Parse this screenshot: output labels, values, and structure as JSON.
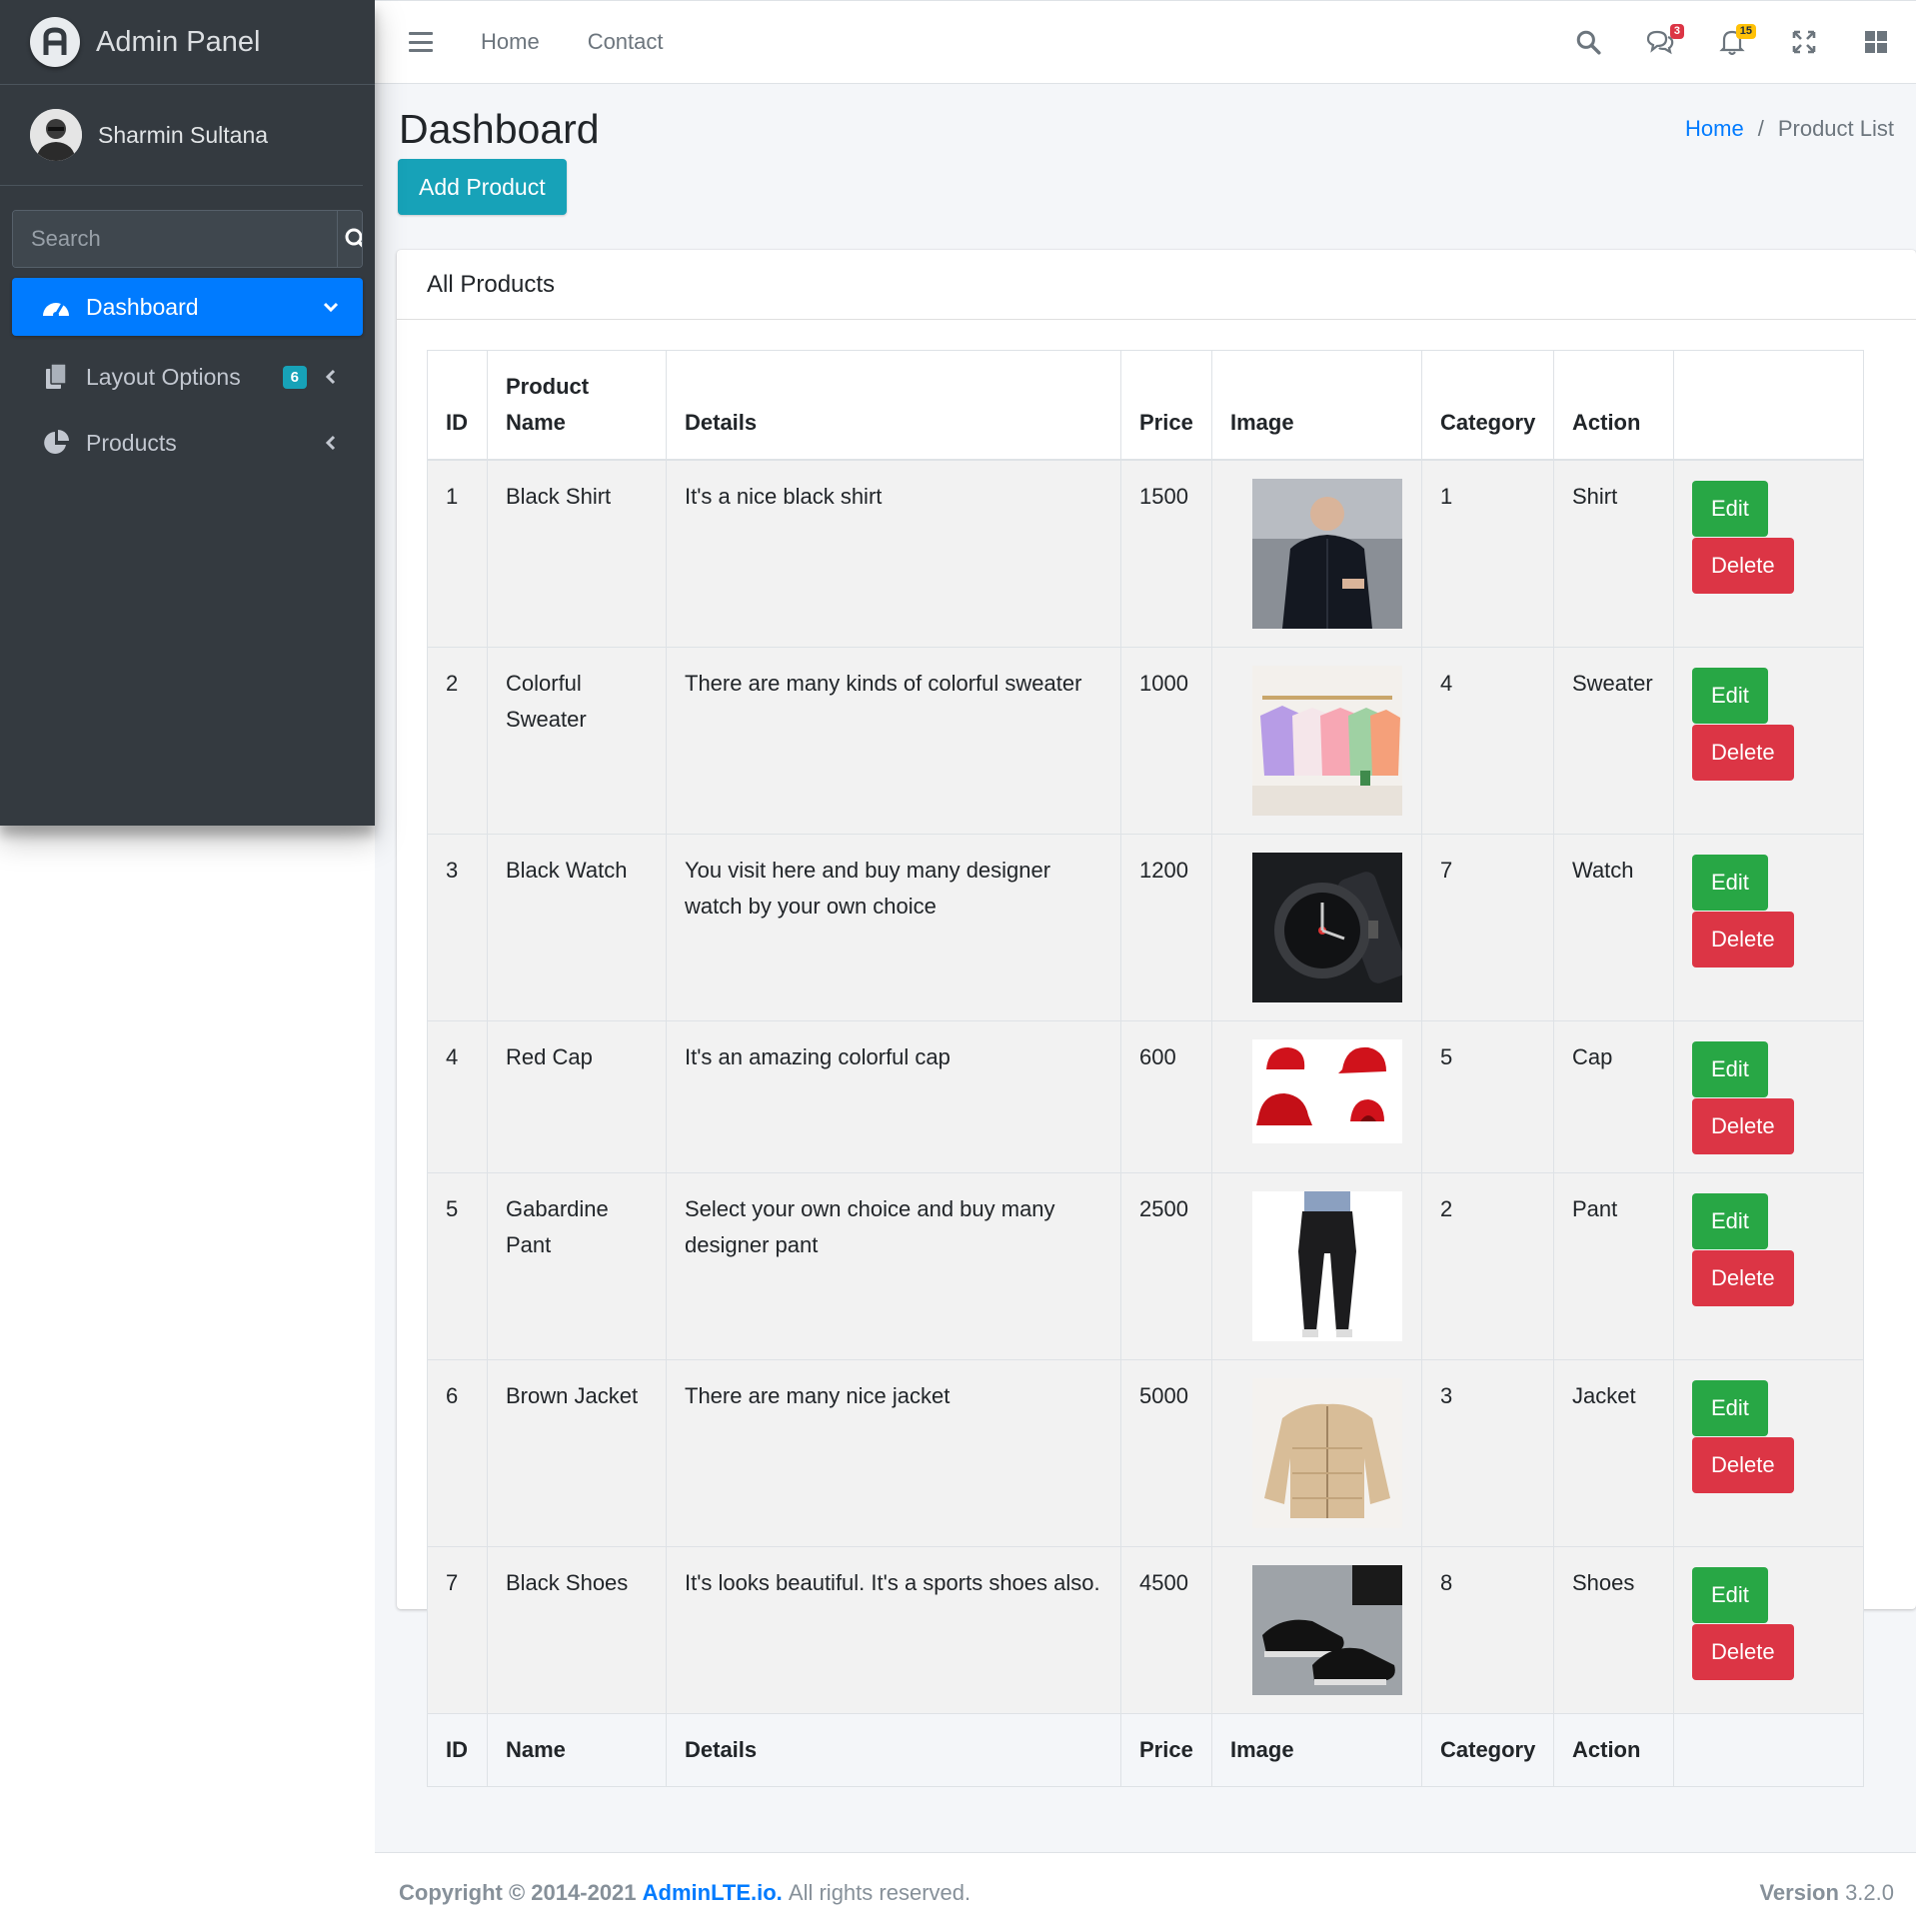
{
  "brand": {
    "name": "Admin Panel"
  },
  "user": {
    "name": "Sharmin Sultana"
  },
  "sidebar": {
    "search_placeholder": "Search",
    "items": [
      {
        "label": "Dashboard",
        "active": true
      },
      {
        "label": "Layout Options",
        "badge": "6"
      },
      {
        "label": "Products"
      }
    ]
  },
  "topbar": {
    "links": [
      "Home",
      "Contact"
    ],
    "messages_badge": "3",
    "notifications_badge": "15"
  },
  "page": {
    "title": "Dashboard",
    "breadcrumb": [
      "Home",
      "Product List"
    ],
    "add_button": "Add Product"
  },
  "card": {
    "title": "All Products",
    "columns": [
      "ID",
      "Product Name",
      "Details",
      "Price",
      "Image",
      "Category",
      "Action",
      ""
    ],
    "footer_columns": [
      "ID",
      "Name",
      "Details",
      "Price",
      "Image",
      "Category",
      "Action",
      ""
    ],
    "edit_label": "Edit",
    "delete_label": "Delete",
    "rows": [
      {
        "id": "1",
        "name": "Black Shirt",
        "details": "It's a nice black shirt",
        "price": "1500",
        "category": "1",
        "action": "Shirt",
        "image": "shirt"
      },
      {
        "id": "2",
        "name": "Colorful Sweater",
        "details": "There are many kinds of colorful sweater",
        "price": "1000",
        "category": "4",
        "action": "Sweater",
        "image": "sweater"
      },
      {
        "id": "3",
        "name": "Black Watch",
        "details": "You visit here and buy many designer watch by your own choice",
        "price": "1200",
        "category": "7",
        "action": "Watch",
        "image": "watch"
      },
      {
        "id": "4",
        "name": "Red Cap",
        "details": "It's an amazing colorful cap",
        "price": "600",
        "category": "5",
        "action": "Cap",
        "image": "cap"
      },
      {
        "id": "5",
        "name": "Gabardine Pant",
        "details": "Select your own choice and buy many designer pant",
        "price": "2500",
        "category": "2",
        "action": "Pant",
        "image": "pant"
      },
      {
        "id": "6",
        "name": "Brown Jacket",
        "details": "There are many nice jacket",
        "price": "5000",
        "category": "3",
        "action": "Jacket",
        "image": "jacket"
      },
      {
        "id": "7",
        "name": "Black Shoes",
        "details": "It's looks beautiful. It's a sports shoes also.",
        "price": "4500",
        "category": "8",
        "action": "Shoes",
        "image": "shoes"
      }
    ]
  },
  "footer": {
    "copyright_prefix": "Copyright © 2014-2021",
    "copyright_link": "AdminLTE.io.",
    "rights": "All rights reserved.",
    "version_label": "Version",
    "version_value": "3.2.0"
  },
  "colors": {
    "sidebar_bg": "#343a40",
    "primary": "#007bff",
    "info": "#17a2b8",
    "success": "#28a745",
    "danger": "#dc3545",
    "warning": "#ffc107"
  }
}
